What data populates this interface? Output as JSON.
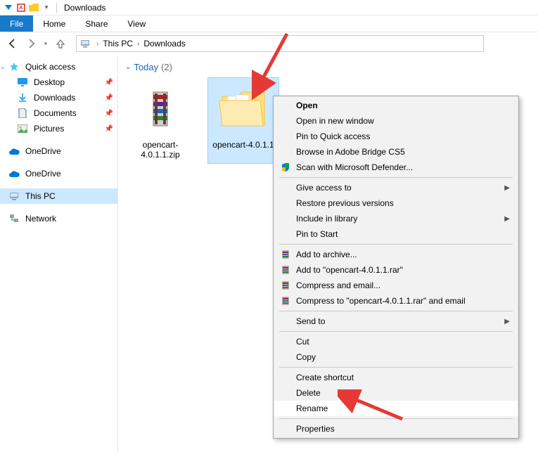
{
  "titlebar": {
    "title": "Downloads"
  },
  "ribbon": {
    "file": "File",
    "home": "Home",
    "share": "Share",
    "view": "View"
  },
  "breadcrumb": {
    "root": "This PC",
    "current": "Downloads"
  },
  "sidebar": {
    "quick_access": "Quick access",
    "desktop": "Desktop",
    "downloads": "Downloads",
    "documents": "Documents",
    "pictures": "Pictures",
    "onedrive1": "OneDrive",
    "onedrive2": "OneDrive",
    "this_pc": "This PC",
    "network": "Network"
  },
  "content": {
    "group_label": "Today",
    "group_count": "(2)",
    "items": [
      {
        "name": "opencart-4.0.1.1.zip"
      },
      {
        "name": "opencart-4.0.1.1"
      }
    ]
  },
  "context_menu": {
    "open": "Open",
    "open_new": "Open in new window",
    "pin_quick": "Pin to Quick access",
    "browse_bridge": "Browse in Adobe Bridge CS5",
    "scan_defender": "Scan with Microsoft Defender...",
    "give_access": "Give access to",
    "restore_prev": "Restore previous versions",
    "include_lib": "Include in library",
    "pin_start": "Pin to Start",
    "add_archive": "Add to archive...",
    "add_rar": "Add to \"opencart-4.0.1.1.rar\"",
    "compress_email": "Compress and email...",
    "compress_to_email": "Compress to \"opencart-4.0.1.1.rar\" and email",
    "send_to": "Send to",
    "cut": "Cut",
    "copy": "Copy",
    "create_shortcut": "Create shortcut",
    "delete": "Delete",
    "rename": "Rename",
    "properties": "Properties"
  }
}
